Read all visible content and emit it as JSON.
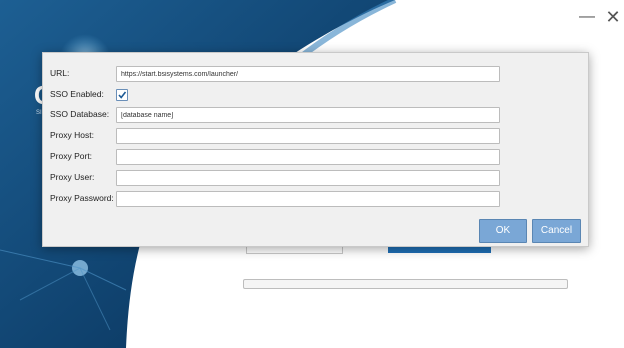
{
  "window": {
    "minimize_label": "—",
    "close_label": "✕"
  },
  "dialog": {
    "fields": [
      {
        "label": "URL:",
        "value": "https://start.bsisystems.com/launcher/",
        "placeholder": ""
      },
      {
        "label": "SSO Enabled:",
        "checked": true
      },
      {
        "label": "SSO Database:",
        "value": "[database name]",
        "placeholder": ""
      },
      {
        "label": "Proxy Host:",
        "value": "",
        "placeholder": ""
      },
      {
        "label": "Proxy Port:",
        "value": "",
        "placeholder": ""
      },
      {
        "label": "Proxy User:",
        "value": "",
        "placeholder": ""
      },
      {
        "label": "Proxy Password:",
        "value": "",
        "placeholder": ""
      }
    ],
    "ok_label": "OK",
    "cancel_label": "Cancel"
  },
  "colors": {
    "background_brand": "#0d3a63",
    "primary_button": "#7aa7d6",
    "background_button": "#1f6fb5"
  }
}
